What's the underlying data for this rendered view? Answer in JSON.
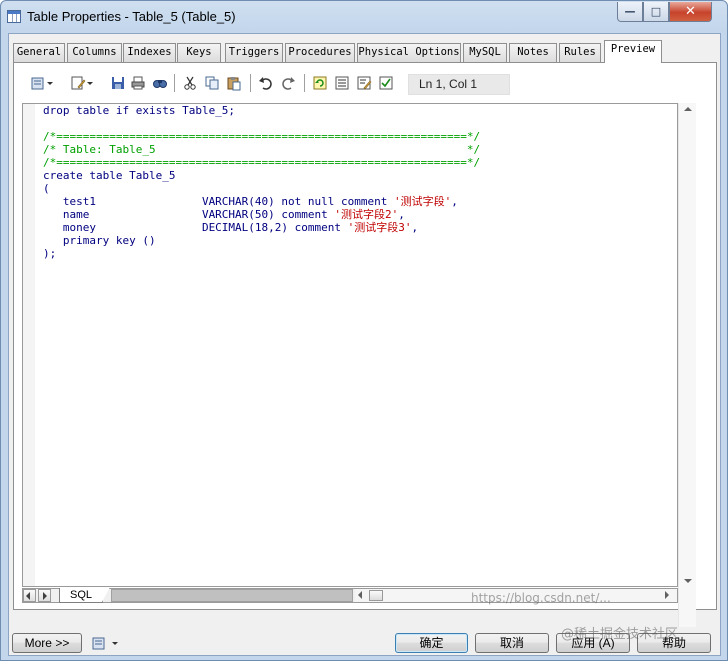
{
  "window": {
    "title": "Table Properties - Table_5 (Table_5)",
    "minimize_glyph": "—",
    "maximize_glyph": "□",
    "close_glyph": "✕"
  },
  "tabs": [
    {
      "label": "General"
    },
    {
      "label": "Columns"
    },
    {
      "label": "Indexes"
    },
    {
      "label": "Keys"
    },
    {
      "label": "Triggers"
    },
    {
      "label": "Procedures"
    },
    {
      "label": "Physical Options"
    },
    {
      "label": "MySQL"
    },
    {
      "label": "Notes"
    },
    {
      "label": "Rules"
    },
    {
      "label": "Preview",
      "active": true
    }
  ],
  "toolbar": {
    "icons": [
      "print-options-icon",
      "edit-icon",
      "save-icon",
      "print-icon",
      "find-icon",
      "cut-icon",
      "copy-icon",
      "paste-icon",
      "undo-icon",
      "redo-icon",
      "refresh-icon",
      "list-icon",
      "edit-list-icon",
      "checklist-icon"
    ],
    "cursor_position": "Ln 1, Col 1"
  },
  "code": {
    "lines": [
      [
        {
          "t": "drop table if exists Table_5;",
          "c": "kw"
        }
      ],
      [
        {
          "t": "",
          "c": "kw"
        }
      ],
      [
        {
          "t": "/*==============================================================*/",
          "c": "cm"
        }
      ],
      [
        {
          "t": "/* Table: Table_5                                               */",
          "c": "cm"
        }
      ],
      [
        {
          "t": "/*==============================================================*/",
          "c": "cm"
        }
      ],
      [
        {
          "t": "create table Table_5",
          "c": "kw"
        }
      ],
      [
        {
          "t": "(",
          "c": "kw"
        }
      ],
      [
        {
          "t": "   test1                VARCHAR(40) not null comment ",
          "c": "kw"
        },
        {
          "t": "'测试字段'",
          "c": "str"
        },
        {
          "t": ",",
          "c": "kw"
        }
      ],
      [
        {
          "t": "   name                 VARCHAR(50) comment ",
          "c": "kw"
        },
        {
          "t": "'测试字段2'",
          "c": "str"
        },
        {
          "t": ",",
          "c": "kw"
        }
      ],
      [
        {
          "t": "   money                DECIMAL(18,2) comment ",
          "c": "kw"
        },
        {
          "t": "'测试字段3'",
          "c": "str"
        },
        {
          "t": ",",
          "c": "kw"
        }
      ],
      [
        {
          "t": "   primary key ()",
          "c": "kw"
        }
      ],
      [
        {
          "t": ");",
          "c": "kw"
        }
      ]
    ]
  },
  "editor_tabs": {
    "sql_label": "SQL"
  },
  "buttons": {
    "more": "More >>",
    "ok": "确定",
    "cancel": "取消",
    "apply": "应用 (A)",
    "help": "帮助"
  },
  "watermark": {
    "url": "https://blog.csdn.net/...",
    "brand": "@稀土掘金技术社区"
  },
  "colors": {
    "keyword": "#000080",
    "comment": "#00a000",
    "string": "#c00000",
    "default_button_border": "#3c7fb1"
  }
}
